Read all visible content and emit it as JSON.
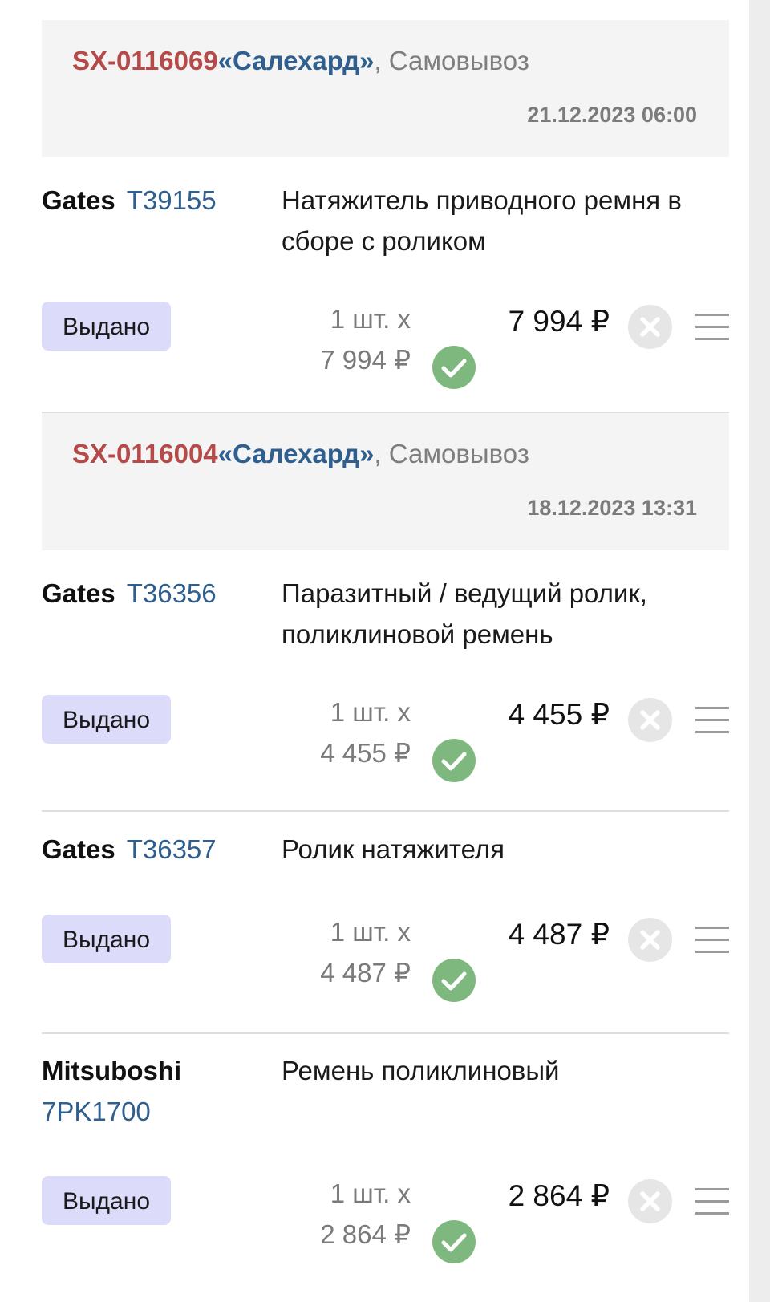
{
  "orders": [
    {
      "order_id": "SX-0116069",
      "quote_open": "«",
      "city": "Салехард",
      "quote_close": "»",
      "delivery": ", Самовывоз",
      "date": "21.12.2023 06:00",
      "items": [
        {
          "brand": "Gates",
          "article": "T39155",
          "description": "Натяжитель приводного ремня в сборе с роликом",
          "status": "Выдано",
          "quantity": "1 шт. х",
          "unit_price": "7 994 ₽",
          "total": "7 994 ₽",
          "check_icon": "check-circle-icon",
          "cancel_icon": "cancel-circle-icon",
          "menu_icon": "menu-lines-icon"
        }
      ]
    },
    {
      "order_id": "SX-0116004",
      "quote_open": "«",
      "city": "Салехард",
      "quote_close": "»",
      "delivery": ", Самовывоз",
      "date": "18.12.2023 13:31",
      "items": [
        {
          "brand": "Gates",
          "article": "T36356",
          "description": "Паразитный / ведущий ролик, поликлиновой ремень",
          "status": "Выдано",
          "quantity": "1 шт. х",
          "unit_price": "4 455 ₽",
          "total": "4 455 ₽",
          "check_icon": "check-circle-icon",
          "cancel_icon": "cancel-circle-icon",
          "menu_icon": "menu-lines-icon"
        },
        {
          "brand": "Gates",
          "article": "T36357",
          "description": "Ролик натяжителя",
          "status": "Выдано",
          "quantity": "1 шт. х",
          "unit_price": "4 487 ₽",
          "total": "4 487 ₽",
          "check_icon": "check-circle-icon",
          "cancel_icon": "cancel-circle-icon",
          "menu_icon": "menu-lines-icon"
        },
        {
          "brand": "Mitsuboshi",
          "article": "7PK1700",
          "description": "Ремень поликлиновый",
          "status": "Выдано",
          "quantity": "1 шт. х",
          "unit_price": "2 864 ₽",
          "total": "2 864 ₽",
          "check_icon": "check-circle-icon",
          "cancel_icon": "cancel-circle-icon",
          "menu_icon": "menu-lines-icon"
        }
      ]
    }
  ],
  "colors": {
    "order_id": "#b54a48",
    "city": "#2f5f8e",
    "article": "#2f5f8e",
    "status_badge_bg": "#dcdcfa",
    "check_green": "#7fb87f",
    "cancel_grey": "#e6e6e6",
    "header_bg": "#f4f4f4"
  }
}
